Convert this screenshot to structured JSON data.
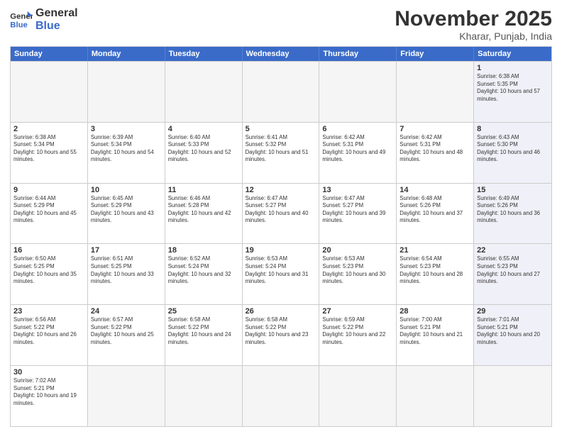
{
  "header": {
    "logo_general": "General",
    "logo_blue": "Blue",
    "month_title": "November 2025",
    "location": "Kharar, Punjab, India"
  },
  "weekdays": [
    "Sunday",
    "Monday",
    "Tuesday",
    "Wednesday",
    "Thursday",
    "Friday",
    "Saturday"
  ],
  "rows": [
    [
      {
        "day": "",
        "info": ""
      },
      {
        "day": "",
        "info": ""
      },
      {
        "day": "",
        "info": ""
      },
      {
        "day": "",
        "info": ""
      },
      {
        "day": "",
        "info": ""
      },
      {
        "day": "",
        "info": ""
      },
      {
        "day": "1",
        "info": "Sunrise: 6:38 AM\nSunset: 5:35 PM\nDaylight: 10 hours and 57 minutes."
      }
    ],
    [
      {
        "day": "2",
        "info": "Sunrise: 6:38 AM\nSunset: 5:34 PM\nDaylight: 10 hours and 55 minutes."
      },
      {
        "day": "3",
        "info": "Sunrise: 6:39 AM\nSunset: 5:34 PM\nDaylight: 10 hours and 54 minutes."
      },
      {
        "day": "4",
        "info": "Sunrise: 6:40 AM\nSunset: 5:33 PM\nDaylight: 10 hours and 52 minutes."
      },
      {
        "day": "5",
        "info": "Sunrise: 6:41 AM\nSunset: 5:32 PM\nDaylight: 10 hours and 51 minutes."
      },
      {
        "day": "6",
        "info": "Sunrise: 6:42 AM\nSunset: 5:31 PM\nDaylight: 10 hours and 49 minutes."
      },
      {
        "day": "7",
        "info": "Sunrise: 6:42 AM\nSunset: 5:31 PM\nDaylight: 10 hours and 48 minutes."
      },
      {
        "day": "8",
        "info": "Sunrise: 6:43 AM\nSunset: 5:30 PM\nDaylight: 10 hours and 46 minutes."
      }
    ],
    [
      {
        "day": "9",
        "info": "Sunrise: 6:44 AM\nSunset: 5:29 PM\nDaylight: 10 hours and 45 minutes."
      },
      {
        "day": "10",
        "info": "Sunrise: 6:45 AM\nSunset: 5:29 PM\nDaylight: 10 hours and 43 minutes."
      },
      {
        "day": "11",
        "info": "Sunrise: 6:46 AM\nSunset: 5:28 PM\nDaylight: 10 hours and 42 minutes."
      },
      {
        "day": "12",
        "info": "Sunrise: 6:47 AM\nSunset: 5:27 PM\nDaylight: 10 hours and 40 minutes."
      },
      {
        "day": "13",
        "info": "Sunrise: 6:47 AM\nSunset: 5:27 PM\nDaylight: 10 hours and 39 minutes."
      },
      {
        "day": "14",
        "info": "Sunrise: 6:48 AM\nSunset: 5:26 PM\nDaylight: 10 hours and 37 minutes."
      },
      {
        "day": "15",
        "info": "Sunrise: 6:49 AM\nSunset: 5:26 PM\nDaylight: 10 hours and 36 minutes."
      }
    ],
    [
      {
        "day": "16",
        "info": "Sunrise: 6:50 AM\nSunset: 5:25 PM\nDaylight: 10 hours and 35 minutes."
      },
      {
        "day": "17",
        "info": "Sunrise: 6:51 AM\nSunset: 5:25 PM\nDaylight: 10 hours and 33 minutes."
      },
      {
        "day": "18",
        "info": "Sunrise: 6:52 AM\nSunset: 5:24 PM\nDaylight: 10 hours and 32 minutes."
      },
      {
        "day": "19",
        "info": "Sunrise: 6:53 AM\nSunset: 5:24 PM\nDaylight: 10 hours and 31 minutes."
      },
      {
        "day": "20",
        "info": "Sunrise: 6:53 AM\nSunset: 5:23 PM\nDaylight: 10 hours and 30 minutes."
      },
      {
        "day": "21",
        "info": "Sunrise: 6:54 AM\nSunset: 5:23 PM\nDaylight: 10 hours and 28 minutes."
      },
      {
        "day": "22",
        "info": "Sunrise: 6:55 AM\nSunset: 5:23 PM\nDaylight: 10 hours and 27 minutes."
      }
    ],
    [
      {
        "day": "23",
        "info": "Sunrise: 6:56 AM\nSunset: 5:22 PM\nDaylight: 10 hours and 26 minutes."
      },
      {
        "day": "24",
        "info": "Sunrise: 6:57 AM\nSunset: 5:22 PM\nDaylight: 10 hours and 25 minutes."
      },
      {
        "day": "25",
        "info": "Sunrise: 6:58 AM\nSunset: 5:22 PM\nDaylight: 10 hours and 24 minutes."
      },
      {
        "day": "26",
        "info": "Sunrise: 6:58 AM\nSunset: 5:22 PM\nDaylight: 10 hours and 23 minutes."
      },
      {
        "day": "27",
        "info": "Sunrise: 6:59 AM\nSunset: 5:22 PM\nDaylight: 10 hours and 22 minutes."
      },
      {
        "day": "28",
        "info": "Sunrise: 7:00 AM\nSunset: 5:21 PM\nDaylight: 10 hours and 21 minutes."
      },
      {
        "day": "29",
        "info": "Sunrise: 7:01 AM\nSunset: 5:21 PM\nDaylight: 10 hours and 20 minutes."
      }
    ],
    [
      {
        "day": "30",
        "info": "Sunrise: 7:02 AM\nSunset: 5:21 PM\nDaylight: 10 hours and 19 minutes."
      },
      {
        "day": "",
        "info": ""
      },
      {
        "day": "",
        "info": ""
      },
      {
        "day": "",
        "info": ""
      },
      {
        "day": "",
        "info": ""
      },
      {
        "day": "",
        "info": ""
      },
      {
        "day": "",
        "info": ""
      }
    ]
  ]
}
